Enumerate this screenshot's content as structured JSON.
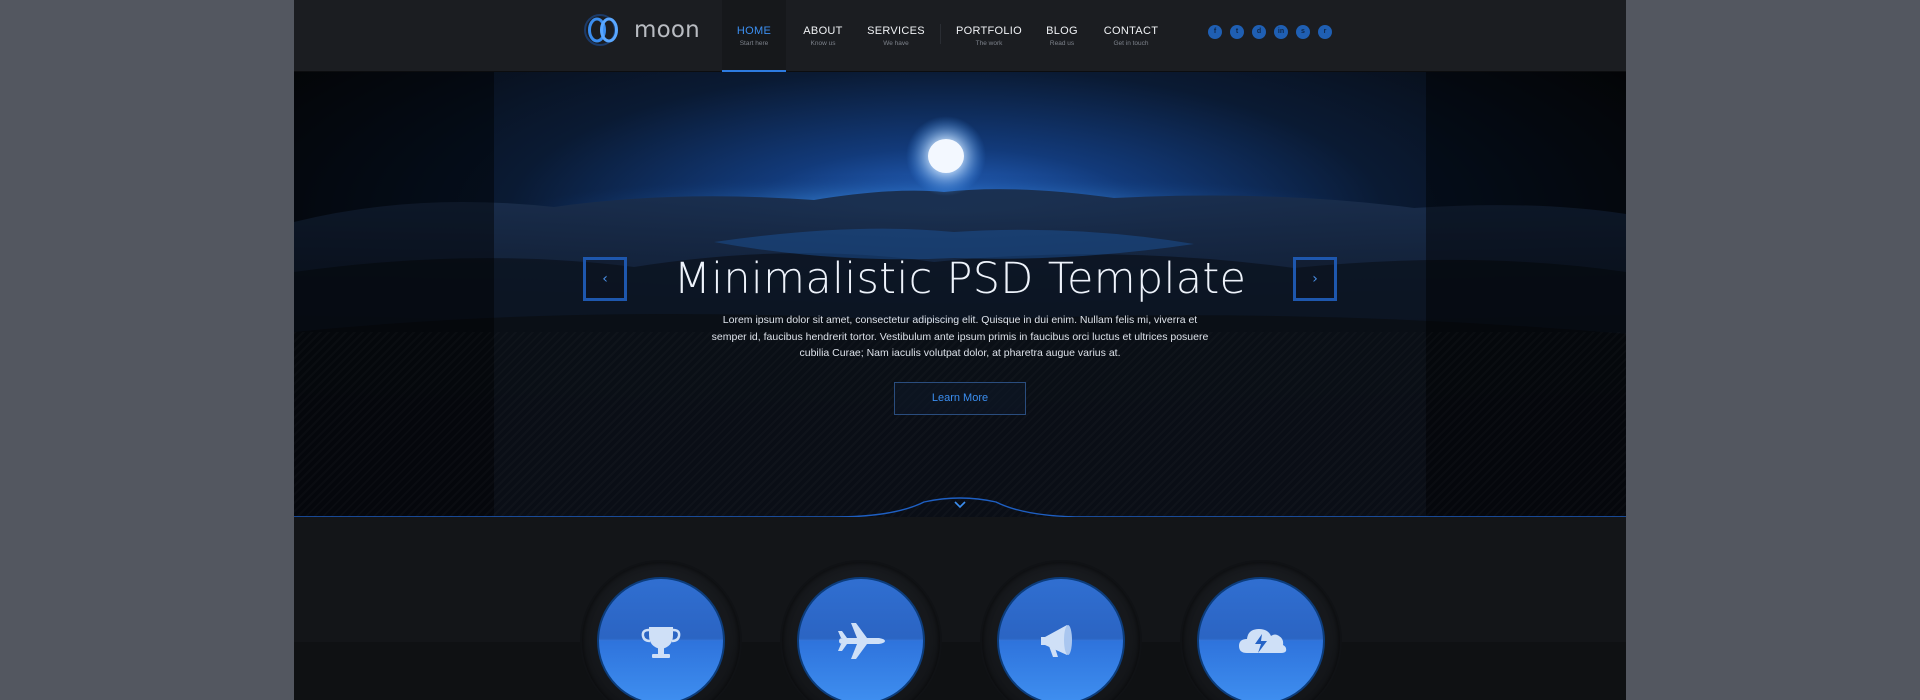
{
  "brand": {
    "name": "moon"
  },
  "nav": [
    {
      "label": "HOME",
      "sub": "Start here",
      "active": true
    },
    {
      "label": "ABOUT",
      "sub": "Know us"
    },
    {
      "label": "SERVICES",
      "sub": "We have"
    },
    {
      "label": "PORTFOLIO",
      "sub": "The work"
    },
    {
      "label": "BLOG",
      "sub": "Read us"
    },
    {
      "label": "CONTACT",
      "sub": "Get in touch"
    }
  ],
  "social": [
    {
      "icon": "facebook-icon",
      "glyph": "f"
    },
    {
      "icon": "twitter-icon",
      "glyph": "t"
    },
    {
      "icon": "dribbble-icon",
      "glyph": "d"
    },
    {
      "icon": "linkedin-icon",
      "glyph": "in"
    },
    {
      "icon": "skype-icon",
      "glyph": "s"
    },
    {
      "icon": "rss-icon",
      "glyph": "r"
    }
  ],
  "hero": {
    "title": "Minimalistic PSD Template",
    "text": "Lorem ipsum dolor sit amet, consectetur adipiscing elit. Quisque in dui enim. Nullam felis mi, viverra et semper id, faucibus hendrerit tortor. Vestibulum ante ipsum primis in faucibus orci luctus et ultrices posuere cubilia Curae; Nam iaculis volutpat dolor, at pharetra augue varius at.",
    "button": "Learn More",
    "prev_glyph": "‹",
    "next_glyph": "›"
  },
  "features": [
    {
      "icon": "trophy-icon"
    },
    {
      "icon": "airplane-icon"
    },
    {
      "icon": "megaphone-icon"
    },
    {
      "icon": "cloud-lightning-icon"
    }
  ],
  "colors": {
    "accent": "#3b8ef0",
    "accent_dark": "#1e57ad",
    "frame_bg": "#535760",
    "page_bg": "#141619"
  }
}
